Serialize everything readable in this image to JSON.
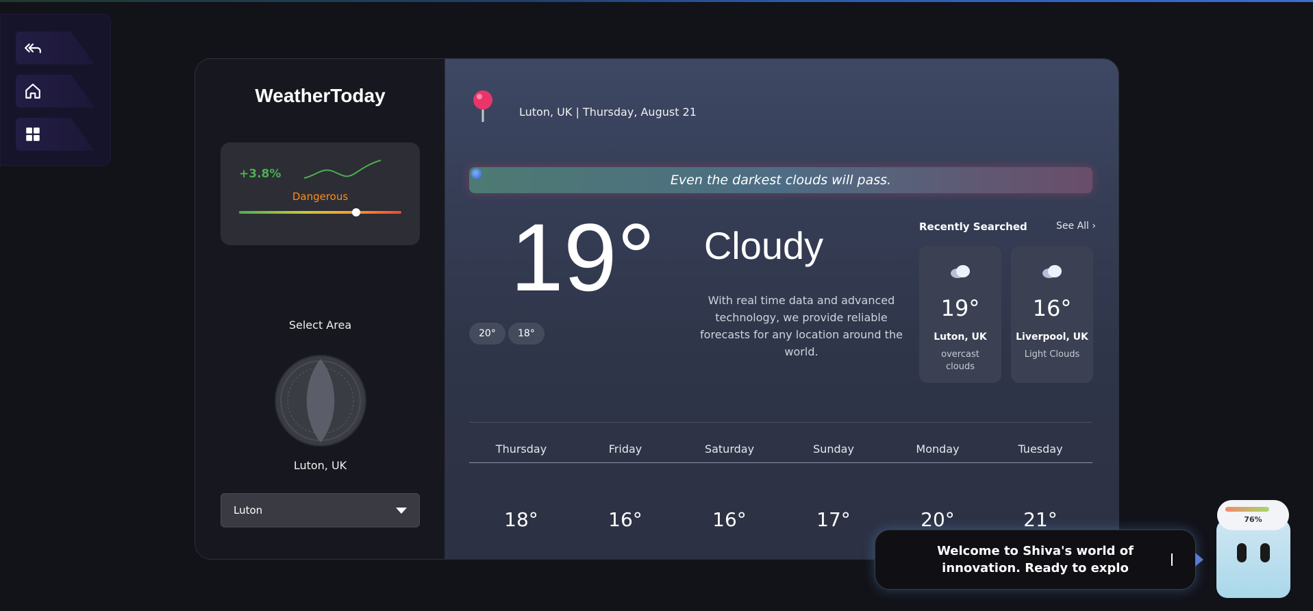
{
  "nav": {
    "items": [
      {
        "icon": "reply-all-icon"
      },
      {
        "icon": "home-icon"
      },
      {
        "icon": "grid-icon"
      }
    ]
  },
  "sidebar": {
    "brand": "WeatherToday",
    "aqi": {
      "change": "+3.8%",
      "status": "Dangerous",
      "level": 0.72
    },
    "select_title": "Select Area",
    "area_name": "Luton, UK",
    "dropdown_value": "Luton"
  },
  "main": {
    "location_line": "Luton, UK | Thursday, August 21",
    "quote": "Even the darkest clouds will pass.",
    "temperature": "19°",
    "high": "20°",
    "low": "18°",
    "condition": "Cloudy",
    "description": "With real time data and advanced technology, we provide reliable forecasts for any location around the world.",
    "recent": {
      "title": "Recently Searched",
      "see_all": "See All ›",
      "items": [
        {
          "temp": "19°",
          "city": "Luton, UK",
          "cond": "overcast clouds",
          "icon": "cloud-icon"
        },
        {
          "temp": "16°",
          "city": "Liverpool, UK",
          "cond": "Light Clouds",
          "icon": "cloud-icon"
        }
      ]
    },
    "forecast": [
      {
        "day": "Thursday",
        "temp": "18°"
      },
      {
        "day": "Friday",
        "temp": "16°"
      },
      {
        "day": "Saturday",
        "temp": "16°"
      },
      {
        "day": "Sunday",
        "temp": "17°"
      },
      {
        "day": "Monday",
        "temp": "20°"
      },
      {
        "day": "Tuesday",
        "temp": "21°"
      }
    ]
  },
  "chat": {
    "message": "Welcome to Shiva's world of innovation. Ready to explo",
    "bot_percent": "76%"
  },
  "colors": {
    "positive": "#4caf50",
    "warning": "#ff8c1a",
    "background": "#121219"
  }
}
